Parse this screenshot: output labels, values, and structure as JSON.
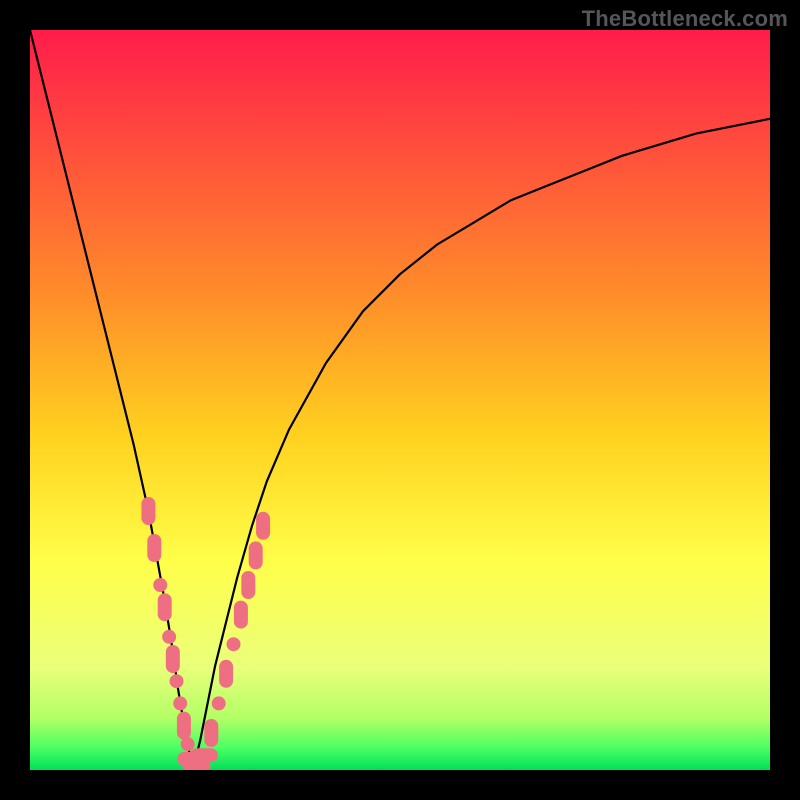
{
  "watermark": "TheBottleneck.com",
  "chart_data": {
    "type": "line",
    "title": "",
    "xlabel": "",
    "ylabel": "",
    "xlim": [
      0,
      100
    ],
    "ylim": [
      0,
      100
    ],
    "gradient_stops": [
      {
        "offset": 0,
        "color": "#ff1c4b"
      },
      {
        "offset": 35,
        "color": "#ff8a2a"
      },
      {
        "offset": 55,
        "color": "#ffd21f"
      },
      {
        "offset": 72,
        "color": "#ffff4a"
      },
      {
        "offset": 86,
        "color": "#eaff7a"
      },
      {
        "offset": 93,
        "color": "#b3ff66"
      },
      {
        "offset": 97,
        "color": "#4bff63"
      },
      {
        "offset": 100,
        "color": "#00e05a"
      }
    ],
    "series": [
      {
        "name": "bottleneck-curve",
        "note": "V-shaped curve; y is distance-from-optimal (0 = no bottleneck, 100 = max). Minimum near x≈22.",
        "x": [
          0,
          2,
          4,
          6,
          8,
          10,
          12,
          14,
          16,
          18,
          19,
          20,
          21,
          22,
          23,
          24,
          25,
          26,
          28,
          30,
          32,
          35,
          40,
          45,
          50,
          55,
          60,
          65,
          70,
          75,
          80,
          85,
          90,
          95,
          100
        ],
        "y": [
          100,
          92,
          84,
          76,
          68,
          60,
          52,
          44,
          35,
          24,
          18,
          11,
          5,
          0,
          4,
          9,
          14,
          18,
          26,
          33,
          39,
          46,
          55,
          62,
          67,
          71,
          74,
          77,
          79,
          81,
          83,
          84.5,
          86,
          87,
          88
        ]
      }
    ],
    "markers": {
      "name": "sample-points",
      "color": "#ef6f82",
      "note": "Pill markers clustered along both arms of the V near the bottom.",
      "points": [
        {
          "x": 16.0,
          "y": 35,
          "shape": "pill-v"
        },
        {
          "x": 16.8,
          "y": 30,
          "shape": "pill-v"
        },
        {
          "x": 17.6,
          "y": 25,
          "shape": "dot"
        },
        {
          "x": 18.2,
          "y": 22,
          "shape": "pill-v"
        },
        {
          "x": 18.8,
          "y": 18,
          "shape": "dot"
        },
        {
          "x": 19.3,
          "y": 15,
          "shape": "pill-v"
        },
        {
          "x": 19.8,
          "y": 12,
          "shape": "dot"
        },
        {
          "x": 20.3,
          "y": 9,
          "shape": "dot"
        },
        {
          "x": 20.8,
          "y": 6,
          "shape": "pill-v"
        },
        {
          "x": 21.3,
          "y": 3.5,
          "shape": "dot"
        },
        {
          "x": 21.8,
          "y": 1.5,
          "shape": "pill-h"
        },
        {
          "x": 22.5,
          "y": 0.5,
          "shape": "pill-h"
        },
        {
          "x": 23.5,
          "y": 2,
          "shape": "pill-h"
        },
        {
          "x": 24.5,
          "y": 5,
          "shape": "pill-v"
        },
        {
          "x": 25.5,
          "y": 9,
          "shape": "dot"
        },
        {
          "x": 26.5,
          "y": 13,
          "shape": "pill-v"
        },
        {
          "x": 27.5,
          "y": 17,
          "shape": "dot"
        },
        {
          "x": 28.5,
          "y": 21,
          "shape": "pill-v"
        },
        {
          "x": 29.5,
          "y": 25,
          "shape": "pill-v"
        },
        {
          "x": 30.5,
          "y": 29,
          "shape": "pill-v"
        },
        {
          "x": 31.5,
          "y": 33,
          "shape": "pill-v"
        }
      ]
    }
  }
}
